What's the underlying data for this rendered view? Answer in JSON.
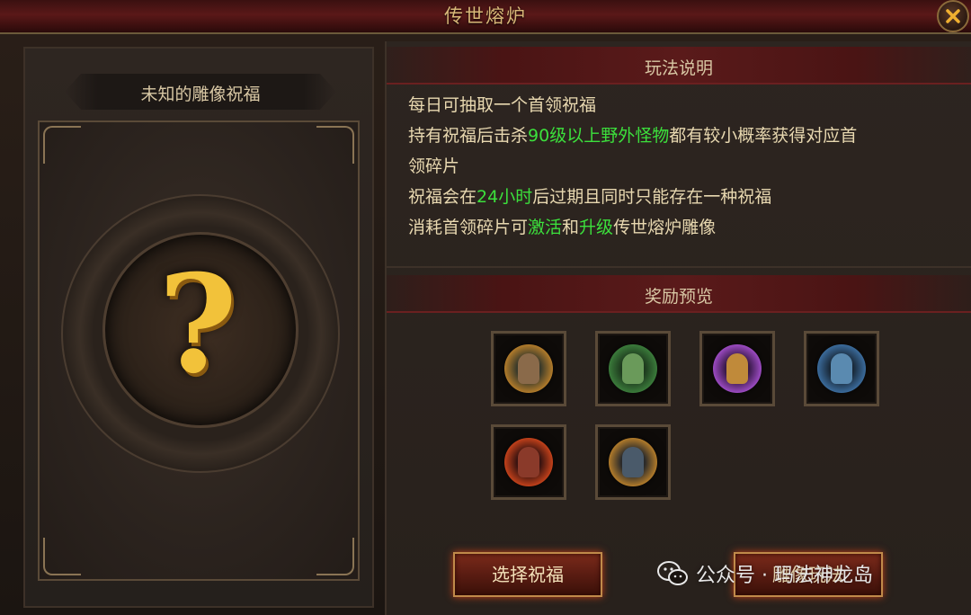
{
  "window": {
    "title": "传世熔炉"
  },
  "left": {
    "statue_title": "未知的雕像祝福",
    "placeholder_symbol": "?"
  },
  "rules": {
    "header": "玩法说明",
    "lines": [
      [
        {
          "t": "每日可抽取一个首领祝福",
          "hl": false
        }
      ],
      [
        {
          "t": "持有祝福后击杀",
          "hl": false
        },
        {
          "t": "90级以上野外怪物",
          "hl": true
        },
        {
          "t": "都有较小概率获得对应首",
          "hl": false
        }
      ],
      [
        {
          "t": "领碎片",
          "hl": false
        }
      ],
      [
        {
          "t": "祝福会在",
          "hl": false
        },
        {
          "t": "24小时",
          "hl": true
        },
        {
          "t": "后过期且同时只能存在一种祝福",
          "hl": false
        }
      ],
      [
        {
          "t": "消耗首领碎片可",
          "hl": false
        },
        {
          "t": "激活",
          "hl": true
        },
        {
          "t": "和",
          "hl": false
        },
        {
          "t": "升级",
          "hl": true
        },
        {
          "t": "传世熔炉雕像",
          "hl": false
        }
      ]
    ],
    "highlight_color": "#3ce03c",
    "text_color": "#e8d8b0"
  },
  "rewards": {
    "header": "奖励预览",
    "items": [
      {
        "name": "boss-portrait-1",
        "bg": "#3a3a2a",
        "ring": "#b07a2a",
        "fig": "#8a6a4a"
      },
      {
        "name": "boss-portrait-2",
        "bg": "#1e3a1e",
        "ring": "#3a7a3a",
        "fig": "#6a9a5a"
      },
      {
        "name": "boss-portrait-3",
        "bg": "#3a1a4a",
        "ring": "#9a4ac0",
        "fig": "#c08a3a"
      },
      {
        "name": "boss-portrait-4",
        "bg": "#1a2a3a",
        "ring": "#3a6a9a",
        "fig": "#5a8ab0"
      },
      {
        "name": "boss-portrait-5",
        "bg": "#3a1410",
        "ring": "#c0401a",
        "fig": "#8a3a2a"
      },
      {
        "name": "boss-portrait-6",
        "bg": "#2a2a2a",
        "ring": "#b07a2a",
        "fig": "#4a5a6a"
      }
    ]
  },
  "buttons": {
    "choose": "选择祝福",
    "statue_gameplay": "雕像玩法"
  },
  "watermark": {
    "text": "公众号 · 玛法神龙岛"
  }
}
